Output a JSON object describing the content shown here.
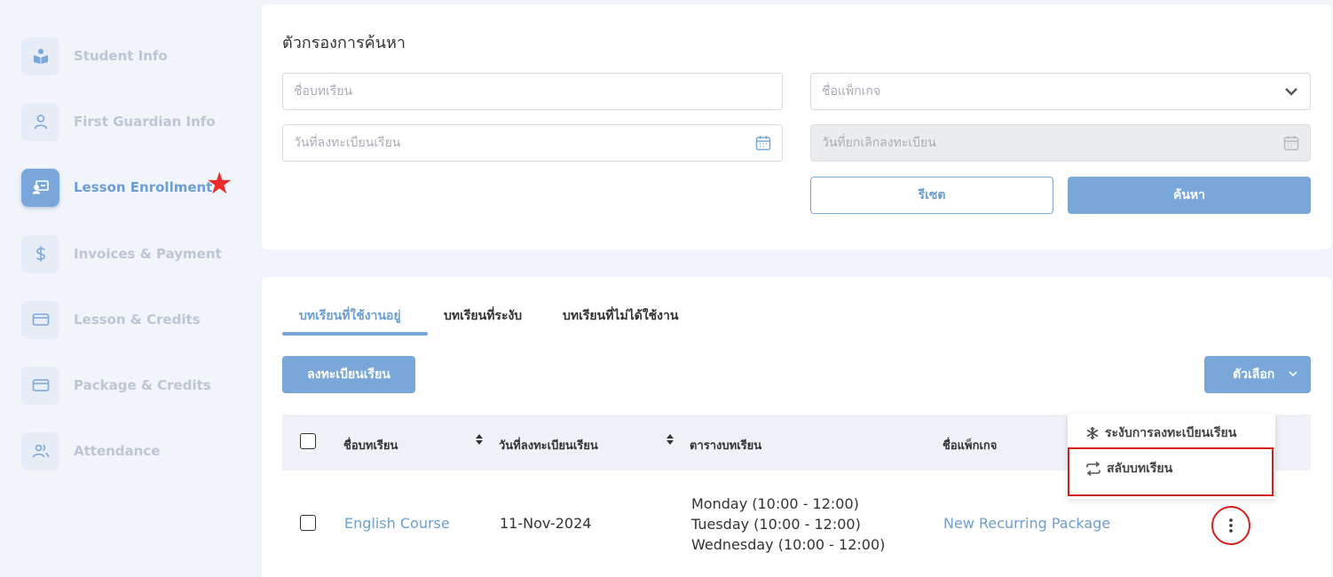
{
  "sidebar": {
    "items": [
      {
        "label": "Student Info",
        "icon": "book-reader-icon"
      },
      {
        "label": "First Guardian Info",
        "icon": "user-icon"
      },
      {
        "label": "Lesson Enrollment",
        "icon": "teacher-board-icon",
        "active": true
      },
      {
        "label": "Invoices & Payment",
        "icon": "dollar-icon"
      },
      {
        "label": "Lesson & Credits",
        "icon": "credit-card-icon"
      },
      {
        "label": "Package & Credits",
        "icon": "credit-card-icon"
      },
      {
        "label": "Attendance",
        "icon": "users-icon"
      }
    ],
    "star": "★"
  },
  "filter": {
    "title": "ตัวกรองการค้นหา",
    "lesson_name_placeholder": "ชื่อบทเรียน",
    "package_name_placeholder": "ชื่อแพ็กเกจ",
    "enroll_date_placeholder": "วันที่ลงทะเบียนเรียน",
    "cancel_date_placeholder": "วันที่ยกเลิกลงทะเบียน",
    "reset_label": "รีเซต",
    "search_label": "ค้นหา"
  },
  "tabs": [
    {
      "label": "บทเรียนที่ใช้งานอยู่",
      "active": true
    },
    {
      "label": "บทเรียนที่ระงับ"
    },
    {
      "label": "บทเรียนที่ไม่ได้ใช้งาน"
    }
  ],
  "toolbar": {
    "enroll_label": "ลงทะเบียนเรียน",
    "options_label": "ตัวเลือก"
  },
  "table": {
    "headers": {
      "lesson_name": "ชื่อบทเรียน",
      "enroll_date": "วันที่ลงทะเบียนเรียน",
      "schedule": "ตารางบทเรียน",
      "package_name": "ชื่อแพ็กเกจ"
    },
    "rows": [
      {
        "lesson_name": "English Course",
        "enroll_date": "11-Nov-2024",
        "schedule": [
          "Monday (10:00 - 12:00)",
          "Tuesday (10:00 - 12:00)",
          "Wednesday (10:00 - 12:00)"
        ],
        "package_name": "New Recurring Package"
      }
    ]
  },
  "menu": {
    "suspend_label": "ระงับการลงทะเบียนเรียน",
    "switch_label": "สลับบทเรียน"
  },
  "colors": {
    "accent": "#7aa7d9",
    "highlight": "#d51f1f"
  }
}
